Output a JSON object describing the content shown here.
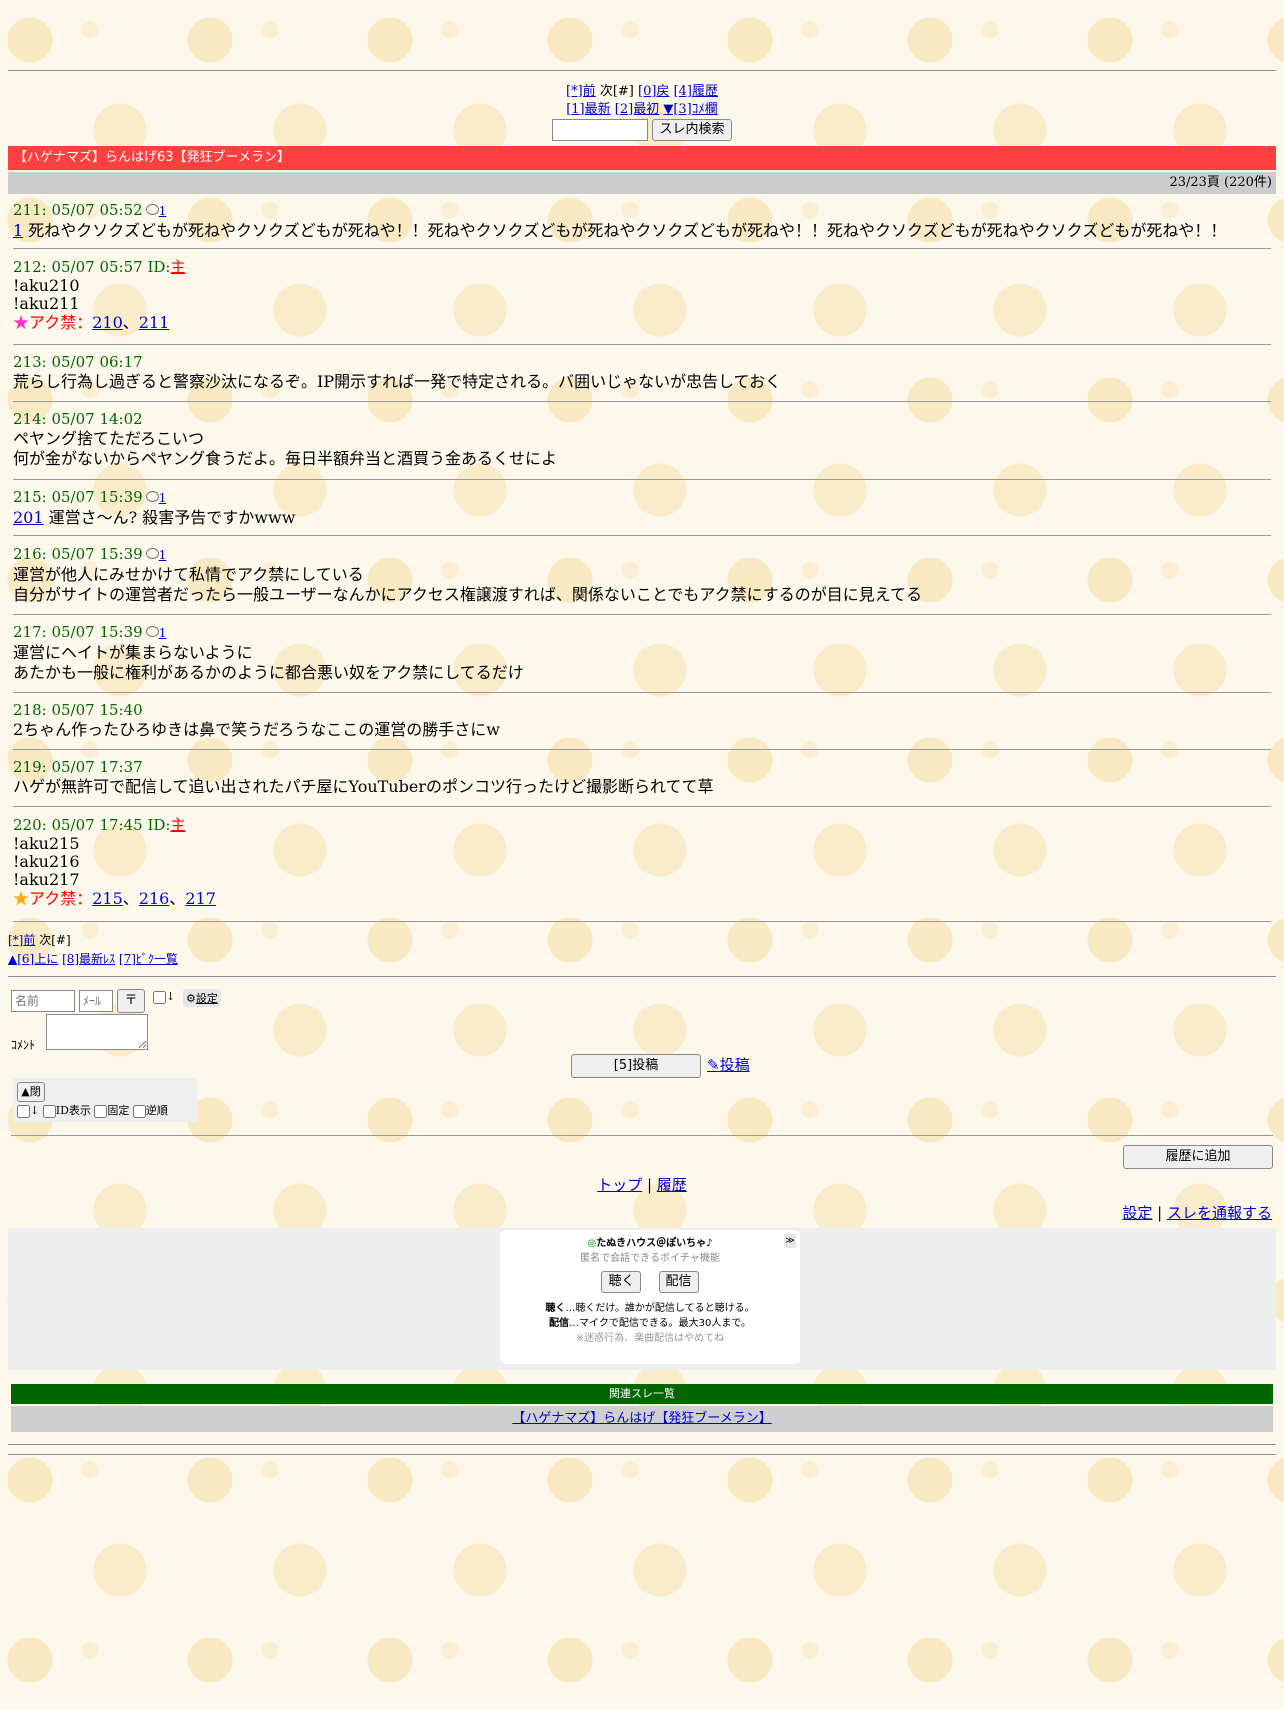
{
  "nav_top": {
    "prev": "[*]前",
    "next": "次[#]",
    "back": "[0]戻",
    "history": "[4]履歴",
    "latest": "[1]最新",
    "first": "[2]最初",
    "comment_field": "▼[3]ｺﾒ欄",
    "search_button": "スレ内検索",
    "search_value": ""
  },
  "thread_title": "【ハゲナマズ】らんはげ63【発狂ブーメラン】",
  "page_info": "23/23頁 (220件)",
  "posts": [
    {
      "header": "211: 05/07 05:52",
      "reply_count": "1",
      "anchor": "1",
      "body": " 死ねやクソクズどもが死ねやクソクズどもが死ねや！！死ねやクソクズどもが死ねやクソクズどもが死ねや！！死ねやクソクズどもが死ねやクソクズどもが死ねや！！"
    },
    {
      "header": "212: 05/07 05:57 ID:",
      "id_label": "主",
      "lines": [
        "!aku210",
        "!aku211"
      ],
      "akukin_label": "アク禁：",
      "akukin_links": [
        "210",
        "211"
      ]
    },
    {
      "header": "213: 05/07 06:17",
      "body": "荒らし行為し過ぎると警察沙汰になるぞ。IP開示すれば一発で特定される。バ囲いじゃないが忠告しておく"
    },
    {
      "header": "214: 05/07 14:02",
      "lines": [
        "ペヤング捨てただろこいつ",
        "何が金がないからペヤング食うだよ。毎日半額弁当と酒買う金あるくせによ"
      ]
    },
    {
      "header": "215: 05/07 15:39",
      "reply_count": "1",
      "anchor": "201",
      "body": " 運営さ～ん? 殺害予告ですかwww"
    },
    {
      "header": "216: 05/07 15:39",
      "reply_count": "1",
      "lines": [
        "運営が他人にみせかけて私情でアク禁にしている",
        "自分がサイトの運営者だったら一般ユーザーなんかにアクセス権譲渡すれば、関係ないことでもアク禁にするのが目に見えてる"
      ]
    },
    {
      "header": "217: 05/07 15:39",
      "reply_count": "1",
      "lines": [
        "運営にヘイトが集まらないように",
        "あたかも一般に権利があるかのように都合悪い奴をアク禁にしてるだけ"
      ]
    },
    {
      "header": "218: 05/07 15:40",
      "body": "2ちゃん作ったひろゆきは鼻で笑うだろうなここの運営の勝手さにw"
    },
    {
      "header": "219: 05/07 17:37",
      "body": "ハゲが無許可で配信して追い出されたパチ屋にYouTuberのポンコツ行ったけど撮影断られてて草"
    },
    {
      "header": "220: 05/07 17:45 ID:",
      "id_label": "主",
      "lines": [
        "!aku215",
        "!aku216",
        "!aku217"
      ],
      "akukin_label": "アク禁：",
      "akukin_links": [
        "215",
        "216",
        "217"
      ]
    }
  ],
  "nav_bottom": {
    "prev": "[*]前",
    "next": "次[#]",
    "up": "▲[6]上に",
    "latest_res": "[8]最新ﾚｽ",
    "pick": "[7]ﾋﾟｸ一覧"
  },
  "form": {
    "name_placeholder": "名前",
    "mail_placeholder": "ﾒｰﾙ",
    "down_label": "↓",
    "settings_label": "設定",
    "comment_label": "ｺﾒﾝﾄ",
    "post_button": "[5]投稿",
    "post_link": "投稿",
    "close_label": "▲閉",
    "opt_down": "↓",
    "opt_id": "ID表示",
    "opt_fixed": "固定",
    "opt_reverse": "逆順"
  },
  "add_history_button": "履歴に追加",
  "footer_links": {
    "top": "トップ",
    "sep": " | ",
    "history": "履歴"
  },
  "footer_right": {
    "settings": "設定",
    "sep": " | ",
    "report": "スレを通報する"
  },
  "voice_chat": {
    "title": "たぬきハウス＠ぽいちゃ",
    "subtitle": "匿名で会話できるボイチャ機能",
    "listen_button": "聴く",
    "broadcast_button": "配信",
    "desc1_bold": "聴く",
    "desc1": "…聴くだけ。誰かが配信してると聴ける。",
    "desc2_bold": "配信",
    "desc2": "…マイクで配信できる。最大30人まで。",
    "note": "※迷惑行為、楽曲配信はやめてね"
  },
  "related": {
    "header": "関連スレ一覧",
    "item": "【ハゲナマズ】らんはげ【発狂ブーメラン】"
  },
  "colors": {
    "title_bar": "#ff4040",
    "post_header": "#006600",
    "related_header": "#006600",
    "link": "#0000cc"
  }
}
